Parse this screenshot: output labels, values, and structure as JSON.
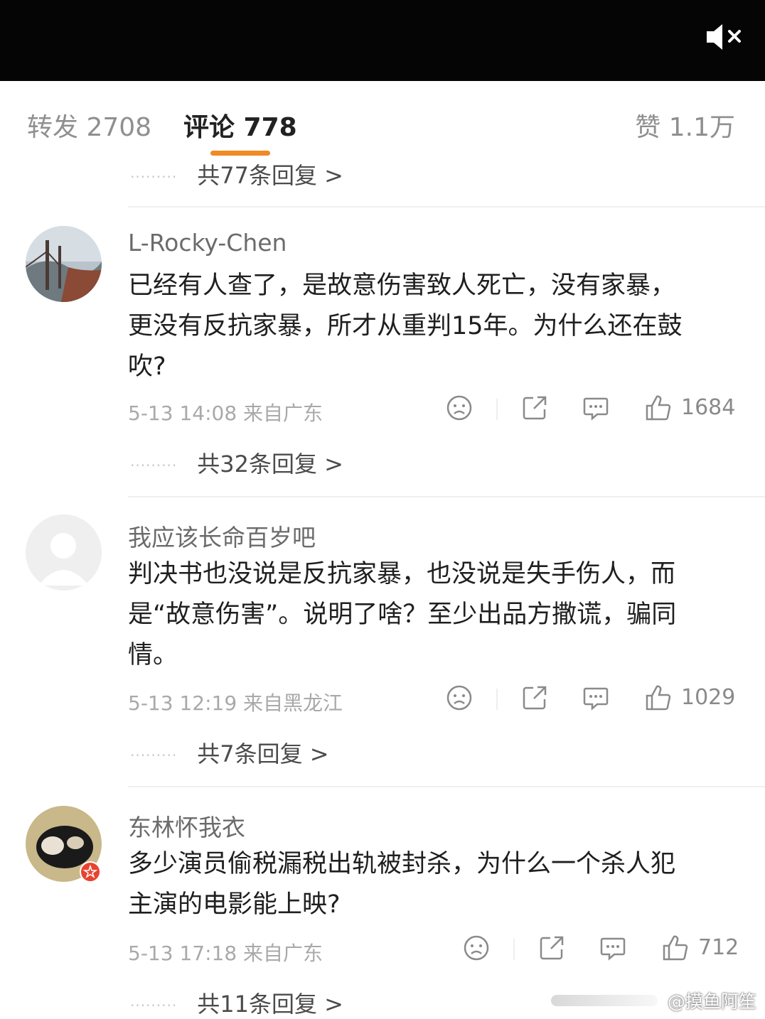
{
  "tabs": {
    "repost": "转发 2708",
    "comments": "评论 778",
    "likes": "赞 1.1万"
  },
  "top_reply_link": "共77条回复 >",
  "comments": [
    {
      "username": "L-Rocky-Chen",
      "lines": [
        "已经有人查了，是故意伤害致人死亡，没有家暴，",
        "更没有反抗家暴，所才从重判15年。为什么还在鼓",
        "吹?"
      ],
      "meta": "5-13 14:08 来自广东",
      "likes": "1684",
      "replies": "共32条回复 >"
    },
    {
      "username": "我应该长命百岁吧",
      "lines": [
        "判决书也没说是反抗家暴，也没说是失手伤人，而",
        "是“故意伤害”。说明了啥？至少出品方撒谎，骗同",
        "情。"
      ],
      "meta": "5-13 12:19 来自黑龙江",
      "likes": "1029",
      "replies": "共7条回复 >"
    },
    {
      "username": "东林怀我衣",
      "lines": [
        "多少演员偷税漏税出轨被封杀，为什么一个杀人犯",
        "主演的电影能上映?"
      ],
      "meta": "5-13 17:18 来自广东",
      "likes": "712",
      "replies": "共11条回复 >"
    }
  ],
  "watermark": "@摸鱼阿笙",
  "icons": [
    "mute-icon",
    "dislike-face-icon",
    "share-icon",
    "comment-icon",
    "thumbs-up-icon"
  ],
  "colors": {
    "accent": "#f08a24",
    "topbar": "#050505"
  }
}
